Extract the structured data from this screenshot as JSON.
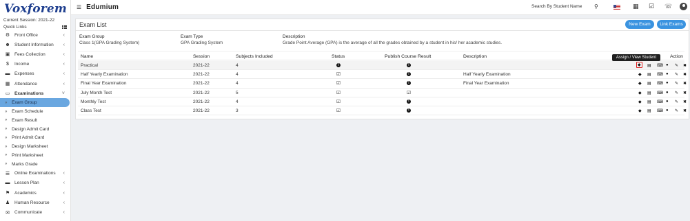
{
  "brand": {
    "logo": "Voxforem",
    "app_name": "Edumium"
  },
  "sidebar": {
    "session": "Current Session: 2021-22",
    "quick_links": "Quick Links",
    "items": [
      {
        "label": "Front Office",
        "icon": "⚙",
        "chev": "‹"
      },
      {
        "label": "Student Information",
        "icon": "☻",
        "chev": "‹"
      },
      {
        "label": "Fees Collection",
        "icon": "▣",
        "chev": "‹"
      },
      {
        "label": "Income",
        "icon": "$",
        "chev": "‹"
      },
      {
        "label": "Expenses",
        "icon": "▬",
        "chev": "‹"
      },
      {
        "label": "Attendance",
        "icon": "▦",
        "chev": "‹"
      },
      {
        "label": "Examinations",
        "icon": "▭",
        "chev": "˅"
      }
    ],
    "exam_sub": [
      "Exam Group",
      "Exam Schedule",
      "Exam Result",
      "Design Admit Card",
      "Print Admit Card",
      "Design Marksheet",
      "Print Marksheet",
      "Marks Grade"
    ],
    "items_after": [
      {
        "label": "Online Examinations",
        "icon": "☰",
        "chev": "‹"
      },
      {
        "label": "Lesson Plan",
        "icon": "▬",
        "chev": "‹"
      },
      {
        "label": "Academics",
        "icon": "⚑",
        "chev": "‹"
      },
      {
        "label": "Human Resource",
        "icon": "♟",
        "chev": "‹"
      },
      {
        "label": "Communicate",
        "icon": "✉",
        "chev": "‹"
      }
    ]
  },
  "topbar": {
    "search_placeholder": "Search By Student Name",
    "search_icon": "⚲",
    "calendar_icon": "▦",
    "tasks_icon": "☑",
    "whatsapp_icon": "☏"
  },
  "main": {
    "title": "Exam List",
    "buttons": {
      "new_exam": "New Exam",
      "link_exams": "Link Exams"
    },
    "meta": {
      "group_label": "Exam Group",
      "group_value": "Class 1(GPA Grading System)",
      "type_label": "Exam Type",
      "type_value": "GPA Grading System",
      "desc_label": "Description",
      "desc_value": "Grade Point Average (GPA) is the average of all the grades obtained by a student in his/ her academic studies."
    },
    "columns": [
      "Name",
      "Session",
      "Subjects Included",
      "Status",
      "Publish Course Result",
      "Description",
      "Action"
    ],
    "rows": [
      {
        "name": "Practical",
        "session": "2021-22",
        "subjects": "4",
        "status": "info",
        "publish": "info",
        "description": ""
      },
      {
        "name": "Half Yearly Examination",
        "session": "2021-22",
        "subjects": "4",
        "status": "check",
        "publish": "info",
        "description": "Half Yearly Examination"
      },
      {
        "name": "Final Year Examination",
        "session": "2021-22",
        "subjects": "4",
        "status": "check",
        "publish": "info",
        "description": "Final Year Examination"
      },
      {
        "name": "July Month Test",
        "session": "2021-22",
        "subjects": "5",
        "status": "check",
        "publish": "check",
        "description": ""
      },
      {
        "name": "Monthly Test",
        "session": "2021-22",
        "subjects": "4",
        "status": "check",
        "publish": "info",
        "description": ""
      },
      {
        "name": "Class Test",
        "session": "2021-22",
        "subjects": "3",
        "status": "check",
        "publish": "info",
        "description": ""
      }
    ],
    "action_icons": [
      "tag-icon",
      "book-icon",
      "keyboard-icon",
      "comment-icon",
      "pencil-icon",
      "close-icon"
    ],
    "tooltip": "Assign / View Student"
  }
}
